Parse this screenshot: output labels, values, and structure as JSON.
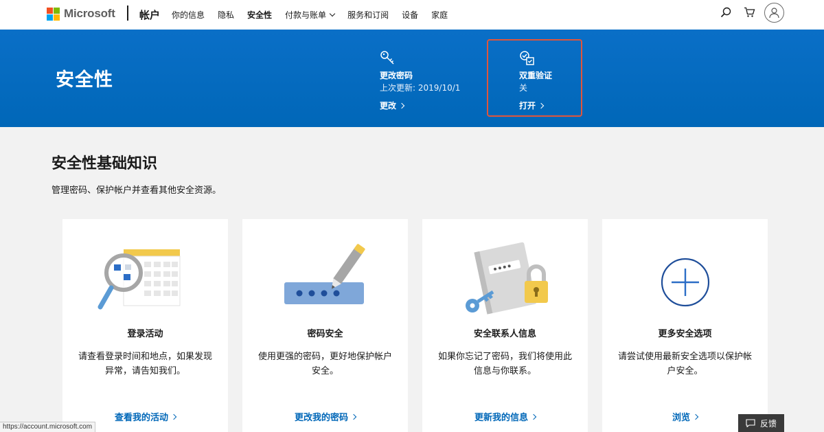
{
  "brand": {
    "name": "Microsoft",
    "colors": [
      "#f25022",
      "#7fba00",
      "#00a4ef",
      "#ffb900"
    ]
  },
  "nav": {
    "app_title": "帐户",
    "links": [
      {
        "label": "你的信息"
      },
      {
        "label": "隐私"
      },
      {
        "label": "安全性"
      },
      {
        "label": "付款与账单"
      },
      {
        "label": "服务和订阅"
      },
      {
        "label": "设备"
      },
      {
        "label": "家庭"
      }
    ],
    "active": "安全性",
    "icons": [
      "search-icon",
      "cart-icon",
      "avatar-icon"
    ]
  },
  "banner": {
    "title": "安全性",
    "color": "#0067b8",
    "items": [
      {
        "icon": "key-icon",
        "title": "更改密码",
        "subtitle": "上次更新: 2019/10/1",
        "link": "更改"
      },
      {
        "icon": "two-step-check-icon",
        "title": "双重验证",
        "subtitle": "关",
        "link": "打开"
      }
    ],
    "highlight_color": "#e2553a"
  },
  "main": {
    "heading": "安全性基础知识",
    "description": "管理密码、保护帐户并查看其他安全资源。",
    "cards": [
      {
        "icon": "calendar-magnifier-icon",
        "title": "登录活动",
        "description": "请查看登录时间和地点，如果发现异常，请告知我们。",
        "link": "查看我的活动"
      },
      {
        "icon": "password-pen-icon",
        "title": "密码安全",
        "description": "使用更强的密码，更好地保护帐户安全。",
        "link": "更改我的密码"
      },
      {
        "icon": "notebook-lock-icon",
        "title": "安全联系人信息",
        "description": "如果你忘记了密码，我们将使用此信息与你联系。",
        "link": "更新我的信息"
      },
      {
        "icon": "plus-circle-icon",
        "title": "更多安全选项",
        "description": "请尝试使用最新安全选项以保护帐户安全。",
        "link": "浏览"
      }
    ],
    "link_color": "#0067b8"
  },
  "statusbar": {
    "url": "https://account.microsoft.com"
  },
  "feedback": {
    "label": "反馈"
  }
}
